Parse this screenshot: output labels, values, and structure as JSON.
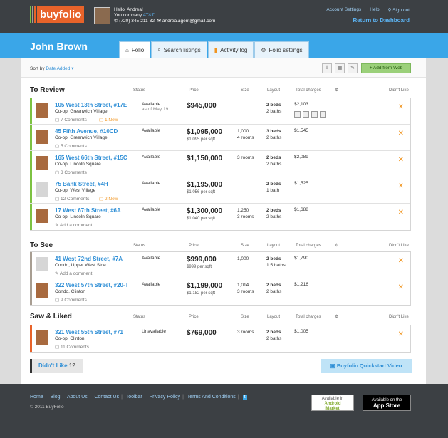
{
  "header": {
    "logo": "buyfolio",
    "greeting": "Hello, Andrea!",
    "company_prefix": "You company",
    "company": "AT&T",
    "phone": "(720) 345-211-32",
    "email": "andrea.agent@gmail.com",
    "links": [
      "Account Settings",
      "Help",
      "Sign out"
    ],
    "return": "Return to Dashboard"
  },
  "client": {
    "name": "John Brown"
  },
  "tabs": [
    {
      "label": "Folio",
      "icon": "home-icon"
    },
    {
      "label": "Search listings",
      "icon": "search-icon"
    },
    {
      "label": "Activity log",
      "icon": "bar-chart-icon"
    },
    {
      "label": "Folio settings",
      "icon": "gear-icon"
    }
  ],
  "sort": {
    "label": "Sort by",
    "value": "Date Added"
  },
  "toolbar": {
    "add_web": "Add from Web"
  },
  "columns": {
    "status": "Status",
    "price": "Price",
    "size": "Size",
    "layout": "Layout",
    "charges": "Total charges",
    "didnt": "Didn't Like"
  },
  "sections": [
    {
      "title": "To Review",
      "color": "#7dc242",
      "listings": [
        {
          "address": "105 West 13th Street, #17E",
          "hood": "Co-op, Greenwich Village",
          "comments": "7 Comments",
          "new": "1 New",
          "status": "Available",
          "status_sub": "as of May 19",
          "price": "$945,000",
          "psub": "",
          "size1": "",
          "size2": "",
          "beds": "2 beds",
          "baths": "2 baths",
          "charges": "$2,103",
          "thumb": "photo"
        },
        {
          "address": "45 Fifth Avenue, #10CD",
          "hood": "Co-op, Greenwich Village",
          "comments": "5 Comments",
          "new": "",
          "status": "Available",
          "status_sub": "",
          "price": "$1,095,000",
          "psub": "$1,095 per sqft",
          "size1": "1,000",
          "size2": "4 rooms",
          "beds": "3 beds",
          "baths": "2 baths",
          "charges": "$1,545",
          "thumb": "photo"
        },
        {
          "address": "165 West 66th Street, #15C",
          "hood": "Co-op, Lincoln Square",
          "comments": "3 Comments",
          "new": "",
          "status": "Available",
          "status_sub": "",
          "price": "$1,150,000",
          "psub": "",
          "size1": "3 rooms",
          "size2": "",
          "beds": "2 beds",
          "baths": "2 baths",
          "charges": "$2,089",
          "thumb": "photo"
        },
        {
          "address": "75 Bank Street, #4H",
          "hood": "Co-op, West Village",
          "comments": "12 Comments",
          "new": "2 New",
          "status": "Available",
          "status_sub": "",
          "price": "$1,195,000",
          "psub": "$1,056 per sqft",
          "size1": "",
          "size2": "",
          "beds": "2 beds",
          "baths": "1 bath",
          "charges": "$1,525",
          "thumb": "grey"
        },
        {
          "address": "17 West 67th Street, #6A",
          "hood": "Co-op, Lincoln Square",
          "comments": "Add a comment",
          "new": "",
          "status": "Available",
          "status_sub": "",
          "price": "$1,300,000",
          "psub": "$1,040 per sqft",
          "size1": "1,250",
          "size2": "3 rooms",
          "beds": "2 beds",
          "baths": "2 baths",
          "charges": "$1,688",
          "thumb": "photo"
        }
      ]
    },
    {
      "title": "To See",
      "color": "#a89e92",
      "listings": [
        {
          "address": "41 West 72nd Street, #7A",
          "hood": "Condo, Upper West Side",
          "comments": "Add a comment",
          "new": "",
          "status": "Available",
          "status_sub": "",
          "price": "$999,000",
          "psub": "$999 per sqft",
          "size1": "1,000",
          "size2": "",
          "beds": "2 beds",
          "baths": "1.5 baths",
          "charges": "$1,790",
          "thumb": "grey"
        },
        {
          "address": "322 West 57th Street, #20-T",
          "hood": "Condo, Clinton",
          "comments": "9 Comments",
          "new": "",
          "status": "Available",
          "status_sub": "",
          "price": "$1,199,000",
          "psub": "$1,182 per sqft",
          "size1": "1,014",
          "size2": "3 rooms",
          "beds": "2 beds",
          "baths": "2 baths",
          "charges": "$1,216",
          "thumb": "photo"
        }
      ]
    },
    {
      "title": "Saw & Liked",
      "color": "#e8632a",
      "listings": [
        {
          "address": "321 West 55th Street, #71",
          "hood": "Co-op, Clinton",
          "comments": "11 Comments",
          "new": "",
          "status": "Unavailable",
          "status_sub": "",
          "price": "$769,000",
          "psub": "",
          "size1": "3 rooms",
          "size2": "",
          "beds": "2 beds",
          "baths": "2 baths",
          "charges": "$1,005",
          "thumb": "photo"
        }
      ]
    }
  ],
  "bottom": {
    "didnt_label": "Didn't Like",
    "didnt_count": "12",
    "quickstart": "Buyfolio Quickstart Video"
  },
  "footer": {
    "links": [
      "Home",
      "Blog",
      "About Us",
      "Contact Us",
      "Toolbar",
      "Privacy Policy",
      "Terms And Conditions"
    ],
    "copyright": "© 2011 BuyFolio",
    "android": [
      "Available in",
      "Android",
      "Market"
    ],
    "appstore": [
      "Available on the",
      "App Store"
    ]
  }
}
